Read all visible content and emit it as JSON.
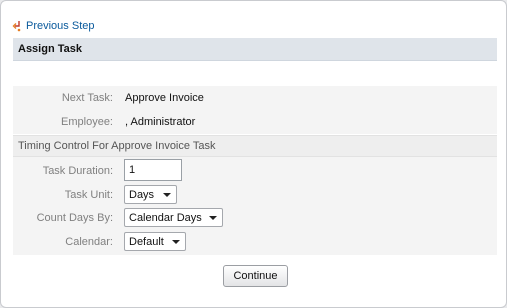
{
  "nav": {
    "previous_step": "Previous Step"
  },
  "section": {
    "title": "Assign Task"
  },
  "details": {
    "next_task_label": "Next Task:",
    "next_task_value": "Approve Invoice",
    "employee_label": "Employee:",
    "employee_value": ", Administrator"
  },
  "timing": {
    "title": "Timing Control For Approve Invoice Task",
    "duration_label": "Task Duration:",
    "duration_value": "1",
    "unit_label": "Task Unit:",
    "unit_value": "Days",
    "count_days_label": "Count Days By:",
    "count_days_value": "Calendar Days",
    "calendar_label": "Calendar:",
    "calendar_value": "Default"
  },
  "actions": {
    "continue_label": "Continue"
  }
}
